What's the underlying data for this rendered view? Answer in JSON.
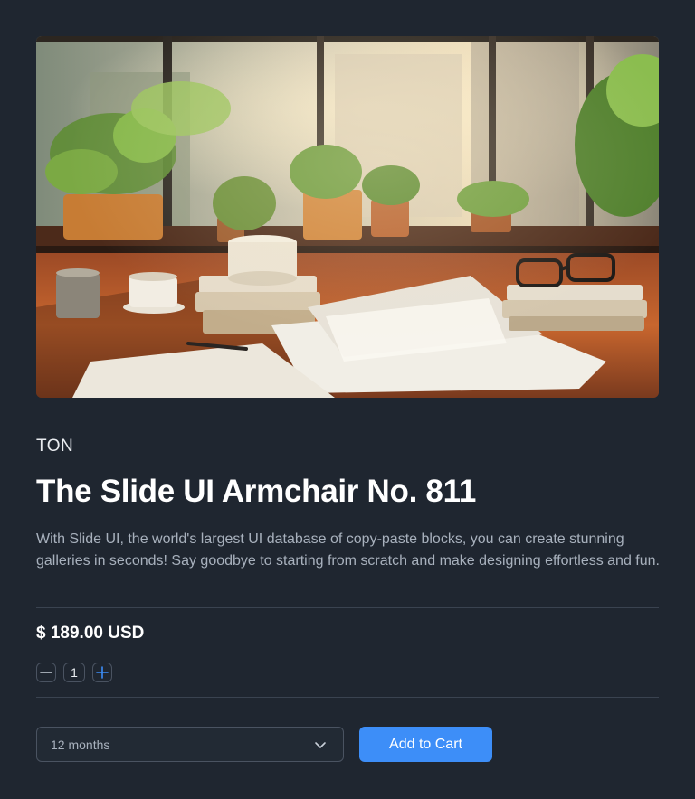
{
  "product": {
    "brand": "TON",
    "title": "The Slide UI Armchair No. 811",
    "description": "With Slide UI, the world's largest UI database of copy-paste blocks, you can create stunning galleries in seconds! Say goodbye to starting from scratch and make designing effortless and fun.",
    "price": "$ 189.00 USD",
    "image_icon": "product-photo"
  },
  "quantity": {
    "value": "1",
    "decrement_icon": "minus-icon",
    "increment_icon": "plus-icon"
  },
  "plan_select": {
    "selected": "12 months",
    "icon": "chevron-down-icon"
  },
  "actions": {
    "add_to_cart_label": "Add to Cart"
  },
  "colors": {
    "background": "#1f2630",
    "accent": "#3d8ef8",
    "text_muted": "#a8b1bd",
    "border": "#4a5361"
  }
}
